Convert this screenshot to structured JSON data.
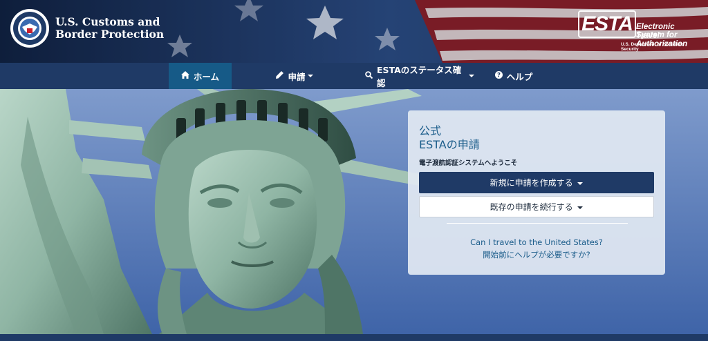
{
  "header": {
    "agency_line1": "U.S. Customs and",
    "agency_line2": "Border Protection",
    "seal_icon": "dhs-seal-icon",
    "esta_logo": "ESTA",
    "esta_tagline_line1": "Electronic System for",
    "esta_tagline_line2": "Travel Authorization",
    "esta_sub": "U.S. Department of Homeland Security"
  },
  "nav": {
    "items": [
      {
        "label": "ホーム",
        "icon": "home-icon",
        "active": true
      },
      {
        "label": "申請",
        "icon": "pencil-icon",
        "dropdown": true
      },
      {
        "label": "ESTAのステータス確認",
        "icon": "search-icon",
        "dropdown": true
      },
      {
        "label": "ヘルプ",
        "icon": "question-circle-icon"
      }
    ]
  },
  "panel": {
    "title_line1": "公式",
    "title_line2": "ESTAの申請",
    "welcome": "電子渡航認証システムへようこそ",
    "new_application": "新規に申請を作成する",
    "continue_application": "既存の申請を続行する",
    "link_travel": "Can I travel to the United States?",
    "link_help": "開始前にヘルプが必要ですか?"
  },
  "colors": {
    "navy": "#1f3a66",
    "active_tab": "#165a87",
    "link": "#1a5c8a"
  }
}
